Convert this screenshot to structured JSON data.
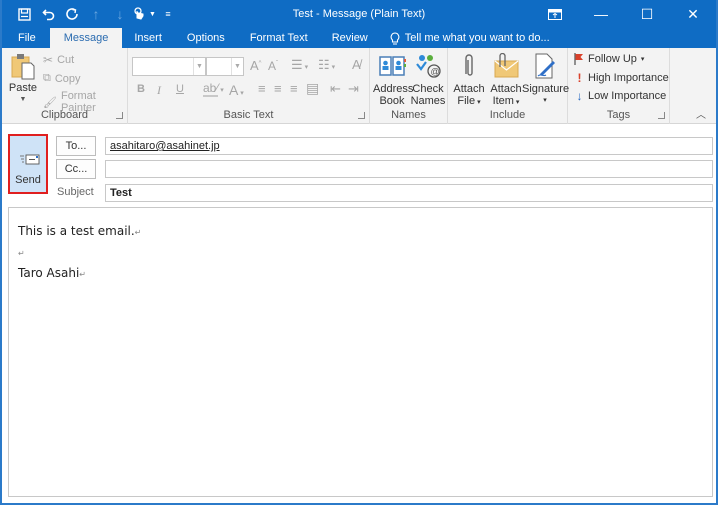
{
  "window": {
    "title": "Test - Message (Plain Text)",
    "controls": [
      {
        "name": "ribbon-display-options",
        "icon": "ribbon-options-icon"
      },
      {
        "name": "minimize",
        "icon": "minimize-icon",
        "glyph": "—"
      },
      {
        "name": "maximize",
        "icon": "maximize-icon",
        "glyph": "☐"
      },
      {
        "name": "close",
        "icon": "close-icon",
        "glyph": "✕"
      }
    ]
  },
  "quick_access": {
    "save": "save-icon",
    "undo": "undo-icon",
    "redo": "redo-icon",
    "previous": "up-arrow-icon",
    "next": "down-arrow-icon",
    "touch_mode": "touch-mode-icon",
    "customize": "customize-qat-icon"
  },
  "tabs": [
    {
      "label": "File",
      "active": false
    },
    {
      "label": "Message",
      "active": true
    },
    {
      "label": "Insert",
      "active": false
    },
    {
      "label": "Options",
      "active": false
    },
    {
      "label": "Format Text",
      "active": false
    },
    {
      "label": "Review",
      "active": false
    }
  ],
  "tell_me": "Tell me what you want to do...",
  "ribbon": {
    "clipboard": {
      "label": "Clipboard",
      "paste": "Paste",
      "cut": "Cut",
      "copy": "Copy",
      "format_painter": "Format Painter"
    },
    "basic_text": {
      "label": "Basic Text",
      "font_name": "",
      "font_size": "",
      "bold": "B",
      "italic": "I",
      "underline": "U",
      "grow_font": "A",
      "shrink_font": "A",
      "font_color": "A"
    },
    "names": {
      "label": "Names",
      "address_book_1": "Address",
      "address_book_2": "Book",
      "check_names_1": "Check",
      "check_names_2": "Names"
    },
    "include": {
      "label": "Include",
      "attach_file_1": "Attach",
      "attach_file_2": "File",
      "attach_item_1": "Attach",
      "attach_item_2": "Item",
      "signature": "Signature"
    },
    "tags": {
      "label": "Tags",
      "follow_up": "Follow Up",
      "high_importance": "High Importance",
      "low_importance": "Low Importance"
    }
  },
  "compose": {
    "send": "Send",
    "to_button": "To...",
    "cc_button": "Cc...",
    "subject_label": "Subject",
    "to_value": "asahitaro@asahinet.jp",
    "cc_value": "",
    "subject_value": "Test",
    "body_lines": [
      "This is a test email.",
      "",
      "Taro Asahi"
    ]
  },
  "colors": {
    "title_bar": "#0f6cc4",
    "ribbon_bg": "#f3f3f3",
    "send_bg": "#cfe3f7",
    "send_highlight": "#e01f1f",
    "follow_up_flag": "#d9412b",
    "high_importance": "#d9412b",
    "low_importance": "#2b6cc4"
  }
}
